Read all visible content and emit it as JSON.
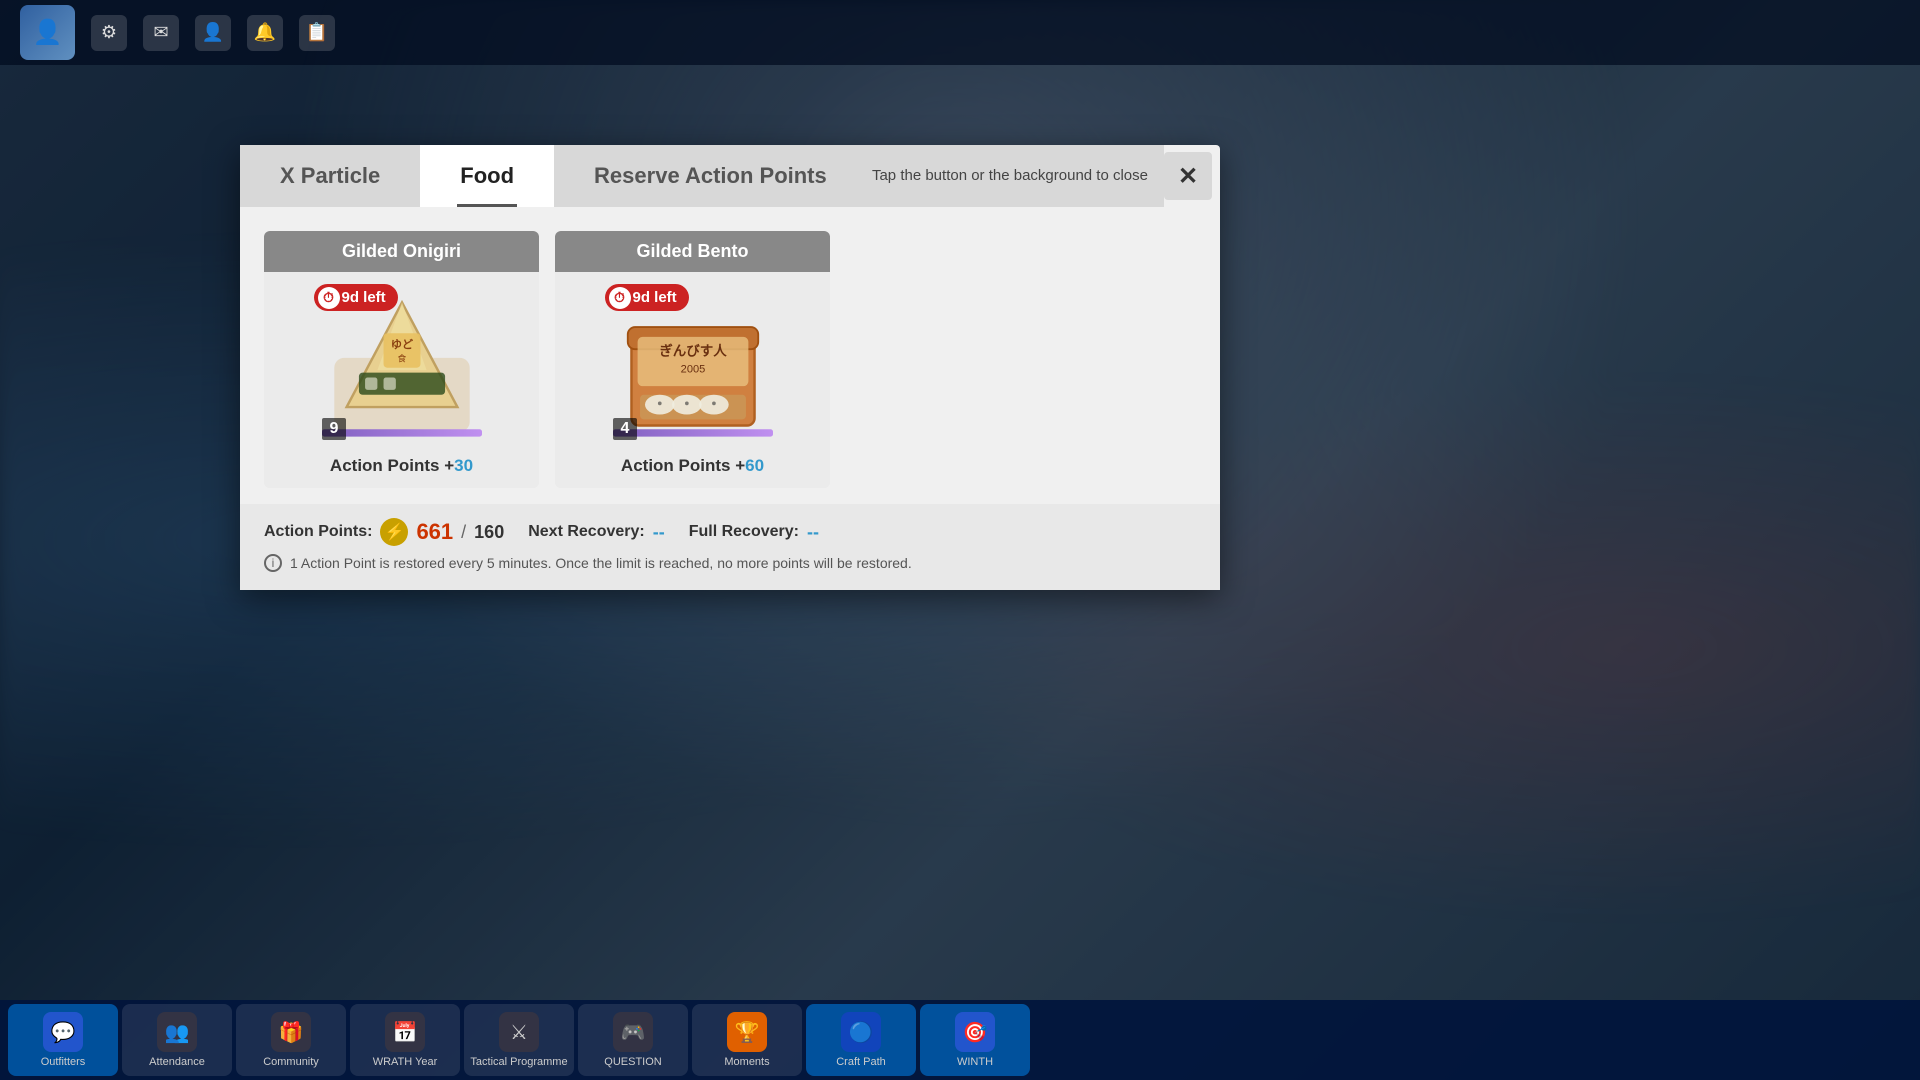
{
  "background": {
    "color": "#2a4060"
  },
  "topbar": {
    "icons": [
      "⚙",
      "✉",
      "👤",
      "🔔",
      "📋"
    ]
  },
  "modal": {
    "tabs": [
      {
        "id": "x-particle",
        "label": "X Particle",
        "active": false
      },
      {
        "id": "food",
        "label": "Food",
        "active": true
      },
      {
        "id": "reserve-action-points",
        "label": "Reserve Action Points",
        "active": false
      }
    ],
    "hint": "Tap the button or the background to close",
    "close_label": "✕",
    "items": [
      {
        "id": "gilded-onigiri",
        "title": "Gilded Onigiri",
        "time_left": "9d left",
        "quantity": 9,
        "action_points_label": "Action Points +",
        "action_points_value": "30",
        "color": "onigiri"
      },
      {
        "id": "gilded-bento",
        "title": "Gilded Bento",
        "time_left": "9d left",
        "quantity": 4,
        "action_points_label": "Action Points +",
        "action_points_value": "60",
        "color": "bento"
      }
    ],
    "footer": {
      "action_points_label": "Action Points:",
      "current_ap": "661",
      "max_ap": "160",
      "next_recovery_label": "Next Recovery:",
      "next_recovery_value": "--",
      "full_recovery_label": "Full Recovery:",
      "full_recovery_value": "--",
      "info_text": "1 Action Point is restored every 5 minutes. Once the limit is reached, no more points will be restored."
    }
  },
  "taskbar": {
    "items": [
      {
        "label": "Outfitters",
        "color": "#2255cc"
      },
      {
        "label": "Attendance",
        "color": "#334"
      },
      {
        "label": "Community",
        "color": "#334"
      },
      {
        "label": "WRATH Year",
        "color": "#334"
      },
      {
        "label": "Tactical Programme",
        "color": "#334"
      },
      {
        "label": "QUESTION",
        "color": "#334"
      },
      {
        "label": "Moments",
        "color": "#e06000"
      },
      {
        "label": "Craft Path",
        "color": "#2255cc"
      },
      {
        "label": "WINTH",
        "color": "#2255cc"
      }
    ]
  }
}
